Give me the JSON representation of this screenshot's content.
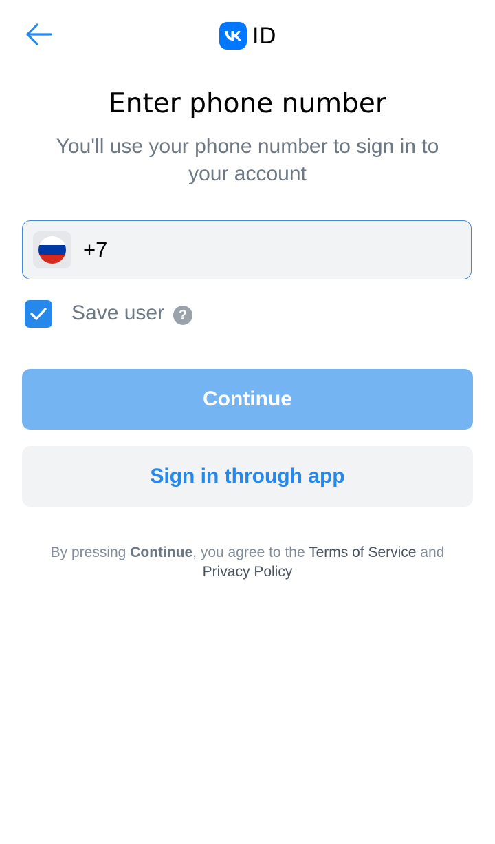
{
  "header": {
    "back_icon": "arrow-left-icon",
    "logo_icon": "vk-logo-icon",
    "logo_text": "ID"
  },
  "main": {
    "title": "Enter phone number",
    "subtitle": "You'll use your phone number to sign in to your account"
  },
  "phone": {
    "country_flag_icon": "russia-flag-icon",
    "value": "+7"
  },
  "save_user": {
    "checked": true,
    "label": "Save user",
    "help_icon": "question-circle-icon",
    "help_glyph": "?"
  },
  "buttons": {
    "continue_label": "Continue",
    "sign_in_app_label": "Sign in through app"
  },
  "legal": {
    "prefix": "By pressing ",
    "continue_word": "Continue",
    "middle": ", you agree to the ",
    "terms_link": "Terms of Service",
    "and": " and ",
    "privacy_link": "Privacy Policy"
  },
  "colors": {
    "accent": "#2688eb",
    "vk_blue": "#0077ff",
    "continue_disabled": "#74b4f2",
    "secondary_bg": "#f2f3f5",
    "secondary_text": "#6d7885"
  }
}
